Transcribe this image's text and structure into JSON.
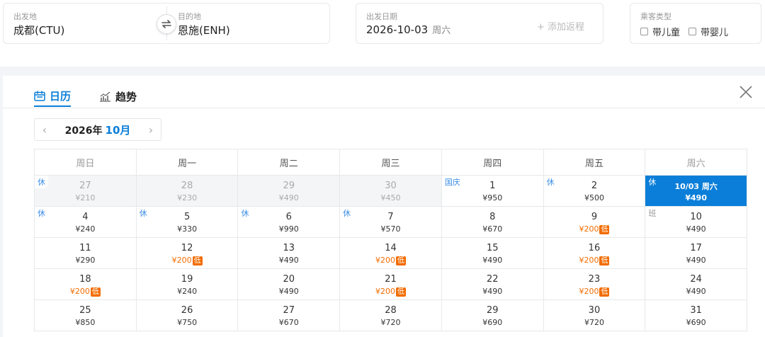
{
  "search": {
    "from_label": "出发地",
    "from_value": "成都(CTU)",
    "to_label": "目的地",
    "to_value": "恩施(ENH)",
    "date_label": "出发日期",
    "date_value": "2026-10-03",
    "date_dow": "周六",
    "add_return": "+ 添加返程",
    "pax_label": "乘客类型",
    "pax_child": "带儿童",
    "pax_infant": "带婴儿"
  },
  "tabs": {
    "calendar": "日历",
    "trend": "趋势"
  },
  "month_nav": {
    "year": "2026年",
    "month": "10月"
  },
  "weekdays": [
    "周日",
    "周一",
    "周二",
    "周三",
    "周四",
    "周五",
    "周六"
  ],
  "colors": {
    "accent": "#0a7ed8",
    "low_price": "#f36c00",
    "holiday_tag": "#3a8ee6"
  },
  "weeks": [
    [
      {
        "day": "27",
        "price": "¥210",
        "past": true,
        "tag": "休"
      },
      {
        "day": "28",
        "price": "¥230",
        "past": true
      },
      {
        "day": "29",
        "price": "¥490",
        "past": true
      },
      {
        "day": "30",
        "price": "¥450",
        "past": true
      },
      {
        "day": "1",
        "price": "¥950",
        "tag": "国庆"
      },
      {
        "day": "2",
        "price": "¥500",
        "tag": "休"
      },
      {
        "day": "10/03 周六",
        "price": "¥490",
        "tag": "休",
        "selected": true
      }
    ],
    [
      {
        "day": "4",
        "price": "¥240",
        "tag": "休"
      },
      {
        "day": "5",
        "price": "¥330",
        "tag": "休"
      },
      {
        "day": "6",
        "price": "¥990",
        "tag": "休"
      },
      {
        "day": "7",
        "price": "¥570",
        "tag": "休"
      },
      {
        "day": "8",
        "price": "¥670"
      },
      {
        "day": "9",
        "price": "¥200",
        "low": true
      },
      {
        "day": "10",
        "price": "¥490",
        "tag": "班",
        "work": true
      }
    ],
    [
      {
        "day": "11",
        "price": "¥290"
      },
      {
        "day": "12",
        "price": "¥200",
        "low": true
      },
      {
        "day": "13",
        "price": "¥490"
      },
      {
        "day": "14",
        "price": "¥200",
        "low": true
      },
      {
        "day": "15",
        "price": "¥490"
      },
      {
        "day": "16",
        "price": "¥200",
        "low": true
      },
      {
        "day": "17",
        "price": "¥490"
      }
    ],
    [
      {
        "day": "18",
        "price": "¥200",
        "low": true
      },
      {
        "day": "19",
        "price": "¥240"
      },
      {
        "day": "20",
        "price": "¥490"
      },
      {
        "day": "21",
        "price": "¥200",
        "low": true
      },
      {
        "day": "22",
        "price": "¥490"
      },
      {
        "day": "23",
        "price": "¥200",
        "low": true
      },
      {
        "day": "24",
        "price": "¥490"
      }
    ],
    [
      {
        "day": "25",
        "price": "¥850"
      },
      {
        "day": "26",
        "price": "¥750"
      },
      {
        "day": "27",
        "price": "¥670"
      },
      {
        "day": "28",
        "price": "¥720"
      },
      {
        "day": "29",
        "price": "¥690"
      },
      {
        "day": "30",
        "price": "¥720"
      },
      {
        "day": "31",
        "price": "¥690"
      }
    ]
  ],
  "low_tag": "低"
}
